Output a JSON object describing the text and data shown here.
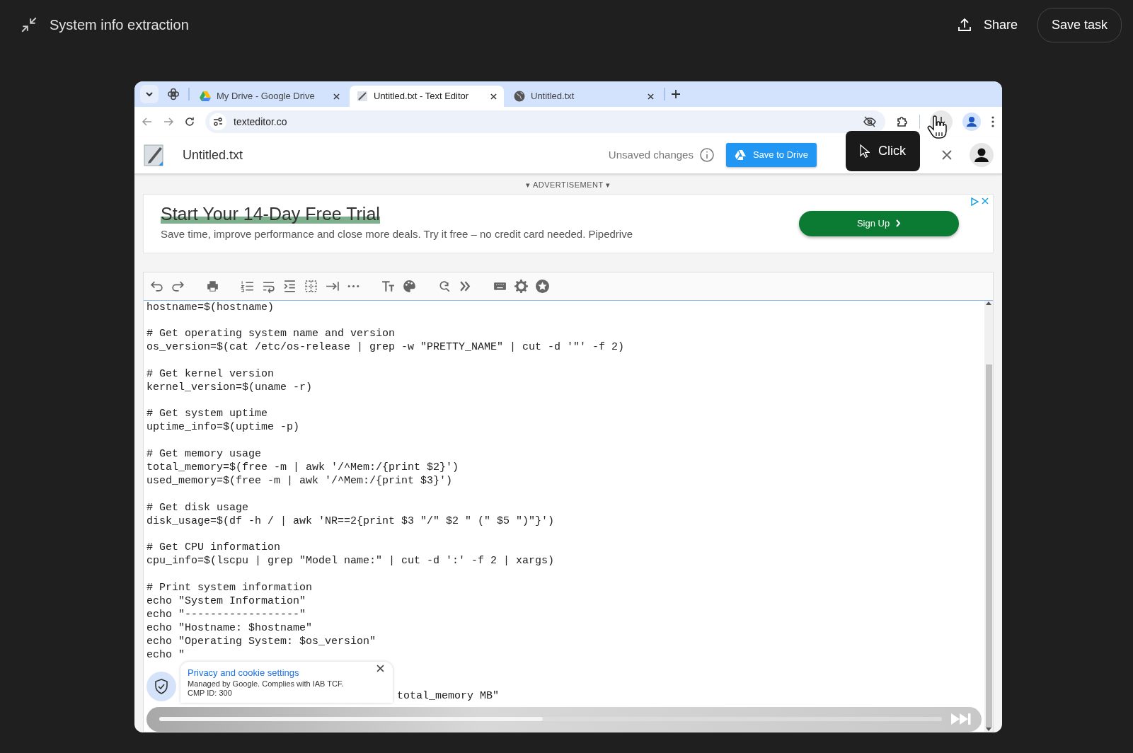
{
  "task": {
    "title": "System info extraction",
    "actions": [
      {
        "label": "Share",
        "kind": "share"
      },
      {
        "label": "Save task",
        "kind": "outline"
      }
    ]
  },
  "browser": {
    "tabs": [
      {
        "label": "My Drive - Google Drive",
        "kind": "drive",
        "selected": false
      },
      {
        "label": "Untitled.txt - Text Editor",
        "kind": "editor",
        "selected": true
      },
      {
        "label": "Untitled.txt",
        "kind": "globe",
        "selected": false
      }
    ],
    "address": "texteditor.co"
  },
  "app": {
    "file_name": "Untitled.txt",
    "status": "Unsaved changes",
    "save_button": "Save to Drive"
  },
  "tooltip": {
    "label": "Click"
  },
  "ad": {
    "label": "▾ ADVERTISEMENT ▾",
    "headline": "Start Your 14-Day Free Trial",
    "body": "Save time, improve performance and close more deals. Try it free – no credit card needed. Pipedrive",
    "button": "Sign Up"
  },
  "editor": {
    "blocks": [
      [
        "hostname=$(hostname)"
      ],
      [
        "# Get operating system name and version",
        "os_version=$(cat /etc/os-release | grep -w \"PRETTY_NAME\" | cut -d '\"' -f 2)"
      ],
      [
        "# Get kernel version",
        "kernel_version=$(uname -r)"
      ],
      [
        "# Get system uptime",
        "uptime_info=$(uptime -p)"
      ],
      [
        "# Get memory usage",
        "total_memory=$(free -m | awk '/^Mem:/{print $2}')",
        "used_memory=$(free -m | awk '/^Mem:/{print $3}')"
      ],
      [
        "# Get disk usage",
        "disk_usage=$(df -h / | awk 'NR==2{print $3 \"/\" $2 \" (\" $5 \")\"}')"
      ],
      [
        "# Get CPU information",
        "cpu_info=$(lscpu | grep \"Model name:\" | cut -d ':' -f 2 | xargs)"
      ],
      [
        "# Print system information",
        "echo \"System Information\"",
        "echo \"------------------\"",
        "echo \"Hostname: $hostname\"",
        "echo \"Operating System: $os_version\"",
        "echo \""
      ]
    ],
    "covered_fragment": "total_memory MB\""
  },
  "cookie_popup": {
    "title": "Privacy and cookie settings",
    "lines": [
      "Managed by Google. Complies with IAB TCF.",
      "CMP ID: 300"
    ]
  },
  "player": {
    "level": 0.49
  }
}
